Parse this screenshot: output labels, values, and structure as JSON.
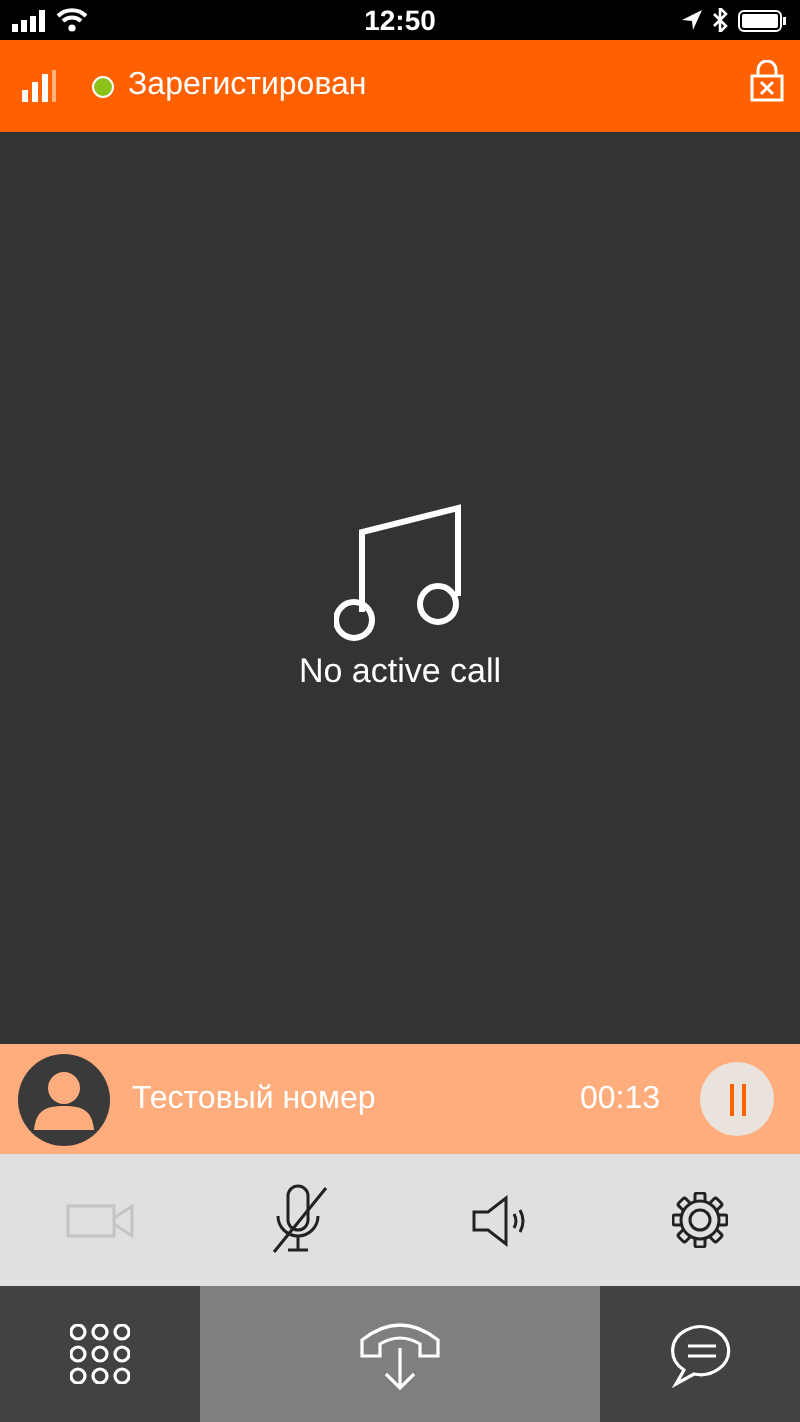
{
  "status_bar": {
    "time": "12:50"
  },
  "header": {
    "status": "Зарегистирован",
    "registered": true
  },
  "main": {
    "message": "No active call"
  },
  "call": {
    "name": "Тестовый номер",
    "duration": "00:13",
    "on_hold": false
  },
  "controls": [
    {
      "kind": "video",
      "disabled": true
    },
    {
      "kind": "mic",
      "muted": true
    },
    {
      "kind": "speaker"
    },
    {
      "kind": "settings"
    }
  ],
  "nav": [
    {
      "kind": "keypad"
    },
    {
      "kind": "hangup"
    },
    {
      "kind": "chat"
    }
  ]
}
